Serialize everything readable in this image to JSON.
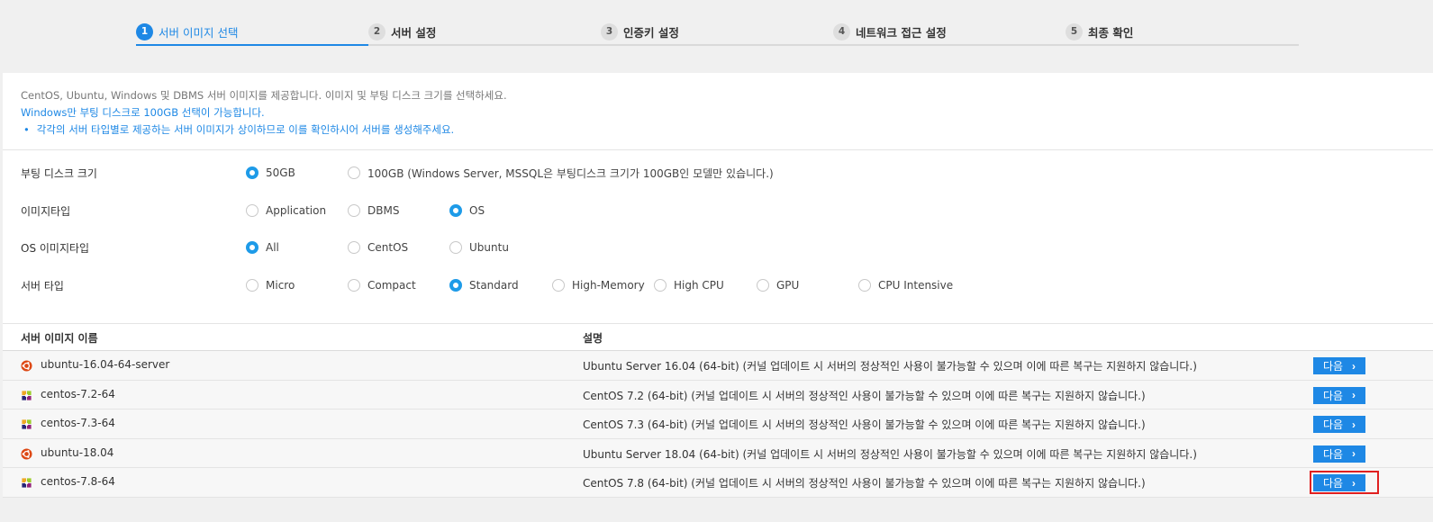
{
  "steps": [
    {
      "num": "1",
      "label": "서버 이미지 선택"
    },
    {
      "num": "2",
      "label": "서버 설정"
    },
    {
      "num": "3",
      "label": "인증키 설정"
    },
    {
      "num": "4",
      "label": "네트워크 접근 설정"
    },
    {
      "num": "5",
      "label": "최종 확인"
    }
  ],
  "info": {
    "line1": "CentOS, Ubuntu, Windows 및 DBMS 서버 이미지를 제공합니다. 이미지 및 부팅 디스크 크기를 선택하세요.",
    "line2": "Windows만 부팅 디스크로 100GB 선택이 가능합니다.",
    "bullet": "각각의 서버 타입별로 제공하는 서버 이미지가 상이하므로 이를 확인하시어 서버를 생성해주세요."
  },
  "options": {
    "boot_disk": {
      "label": "부팅 디스크 크기",
      "choices": [
        "50GB",
        "100GB (Windows Server, MSSQL은 부팅디스크 크기가 100GB인 모델만 있습니다.)"
      ],
      "selected": "50GB"
    },
    "image_type": {
      "label": "이미지타입",
      "choices": [
        "Application",
        "DBMS",
        "OS"
      ],
      "selected": "OS"
    },
    "os_image_type": {
      "label": "OS 이미지타입",
      "choices": [
        "All",
        "CentOS",
        "Ubuntu"
      ],
      "selected": "All"
    },
    "server_type": {
      "label": "서버 타입",
      "choices": [
        "Micro",
        "Compact",
        "Standard",
        "High-Memory",
        "High CPU",
        "GPU",
        "CPU Intensive"
      ],
      "selected": "Standard"
    }
  },
  "table": {
    "col_name": "서버 이미지 이름",
    "col_desc": "설명",
    "next_label": "다음",
    "rows": [
      {
        "icon": "ubuntu-icon",
        "name": "ubuntu-16.04-64-server",
        "desc": "Ubuntu Server 16.04 (64-bit) (커널 업데이트 시 서버의 정상적인 사용이 불가능할 수 있으며 이에 따른 복구는 지원하지 않습니다.)"
      },
      {
        "icon": "centos-icon",
        "name": "centos-7.2-64",
        "desc": "CentOS 7.2 (64-bit) (커널 업데이트 시 서버의 정상적인 사용이 불가능할 수 있으며 이에 따른 복구는 지원하지 않습니다.)"
      },
      {
        "icon": "centos-icon",
        "name": "centos-7.3-64",
        "desc": "CentOS 7.3 (64-bit) (커널 업데이트 시 서버의 정상적인 사용이 불가능할 수 있으며 이에 따른 복구는 지원하지 않습니다.)"
      },
      {
        "icon": "ubuntu-icon",
        "name": "ubuntu-18.04",
        "desc": "Ubuntu Server 18.04 (64-bit) (커널 업데이트 시 서버의 정상적인 사용이 불가능할 수 있으며 이에 따른 복구는 지원하지 않습니다.)"
      },
      {
        "icon": "centos-icon",
        "name": "centos-7.8-64",
        "desc": "CentOS 7.8 (64-bit) (커널 업데이트 시 서버의 정상적인 사용이 불가능할 수 있으며 이에 따른 복구는 지원하지 않습니다.)"
      }
    ]
  },
  "colors": {
    "accent": "#1e88e5",
    "highlight": "#e02020"
  }
}
